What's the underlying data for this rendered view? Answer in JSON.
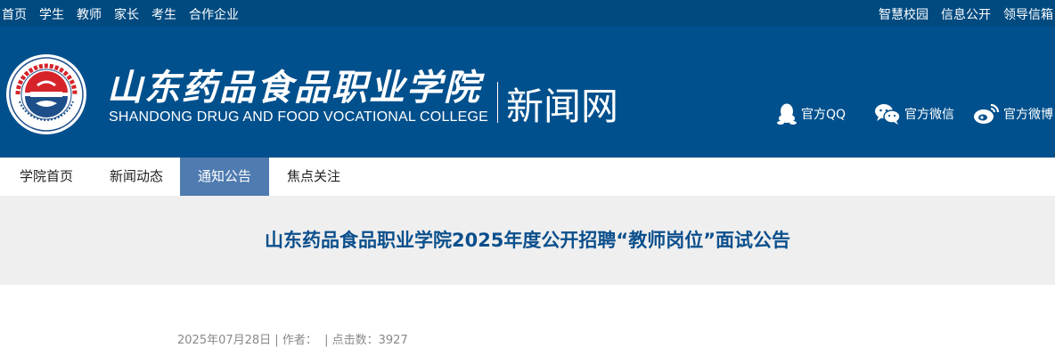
{
  "topbar": {
    "left_links": [
      "首页",
      "学生",
      "教师",
      "家长",
      "考生",
      "合作企业"
    ],
    "right_links": [
      "智慧校园",
      "信息公开",
      "领导信箱"
    ]
  },
  "header": {
    "title_cn": "山东药品食品职业学院",
    "title_en": "SHANDONG DRUG AND FOOD VOCATIONAL COLLEGE",
    "subtitle": "新闻网",
    "social": [
      {
        "label": "官方QQ",
        "icon": "qq-icon"
      },
      {
        "label": "官方微信",
        "icon": "wechat-icon"
      },
      {
        "label": "官方微博",
        "icon": "weibo-icon"
      }
    ],
    "colors": {
      "bar": "#004a80",
      "header": "#00508d"
    }
  },
  "nav": {
    "items": [
      "学院首页",
      "新闻动态",
      "通知公告",
      "焦点关注"
    ],
    "active": "通知公告",
    "active_color": "#4f7bb0"
  },
  "article": {
    "title": "山东药品食品职业学院2025年度公开招聘“教师岗位”面试公告",
    "date": "2025年07月28日",
    "author_label": "作者：",
    "clicks_label": "点击数：",
    "clicks": "3927",
    "title_color": "#0b4f8c"
  }
}
